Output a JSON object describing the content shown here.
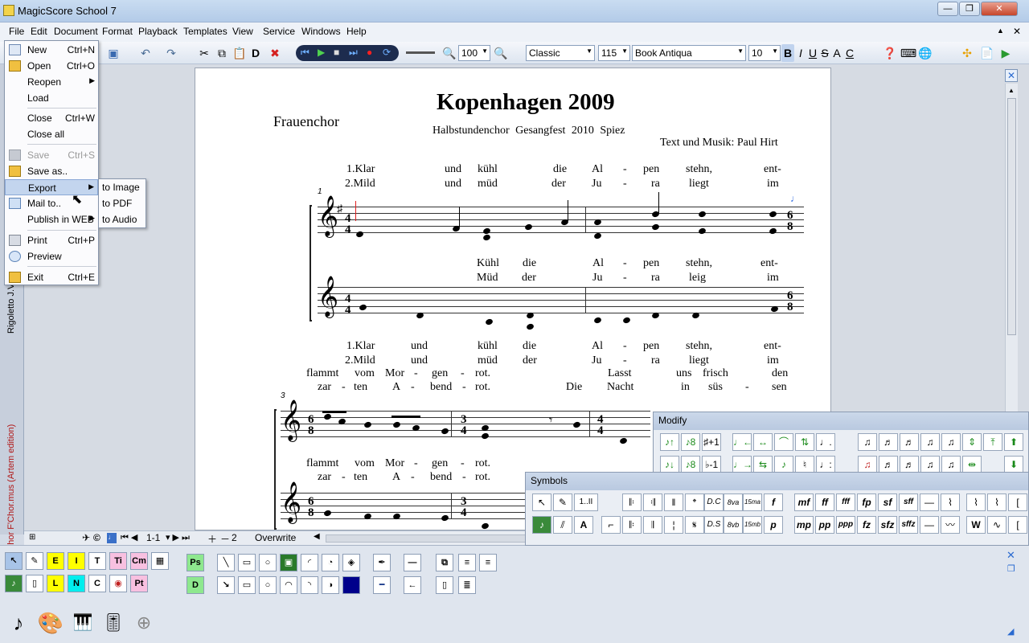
{
  "window": {
    "title": "MagicScore School 7"
  },
  "menubar": {
    "items": [
      "File",
      "Edit",
      "Document",
      "Format",
      "Playback",
      "Templates",
      "View",
      "Service",
      "Windows",
      "Help"
    ]
  },
  "toolbar": {
    "zoom_value": "100",
    "style_combo": "Classic",
    "size_combo": "115",
    "font_combo": "Book Antiqua",
    "fontsize_combo": "10",
    "format_buttons": [
      "B",
      "I",
      "U",
      "S",
      "A",
      "C"
    ],
    "d_button": "D"
  },
  "file_menu": {
    "items": [
      {
        "label": "New",
        "shortcut": "Ctrl+N",
        "icon": "new-document-icon"
      },
      {
        "label": "Open",
        "shortcut": "Ctrl+O",
        "icon": "open-folder-icon"
      },
      {
        "label": "Reopen",
        "shortcut": ""
      },
      {
        "label": "Load",
        "shortcut": ""
      },
      {
        "label": "Close",
        "shortcut": "Ctrl+W"
      },
      {
        "label": "Close all",
        "shortcut": ""
      },
      {
        "label": "Save",
        "shortcut": "Ctrl+S",
        "icon": "save-disk-icon",
        "disabled": true
      },
      {
        "label": "Save as..",
        "shortcut": "",
        "icon": "save-as-icon"
      },
      {
        "label": "Export",
        "shortcut": ""
      },
      {
        "label": "Mail to..",
        "shortcut": "",
        "icon": "mail-icon"
      },
      {
        "label": "Publish in WEB",
        "shortcut": ""
      },
      {
        "label": "Print",
        "shortcut": "Ctrl+P",
        "icon": "printer-icon"
      },
      {
        "label": "Preview",
        "shortcut": "",
        "icon": "preview-icon"
      },
      {
        "label": "Exit",
        "shortcut": "Ctrl+E",
        "icon": "exit-icon"
      }
    ]
  },
  "export_submenu": {
    "items": [
      "to Image",
      "to PDF",
      "to Audio"
    ]
  },
  "score": {
    "title": "Kopenhagen 2009",
    "subtitle": "Halbstundenchor Gesangfest 2010 Spiez",
    "choir": "Frauenchor",
    "composer": "Text und Musik: Paul Hirt",
    "measure_1": "1",
    "measure_3": "3",
    "key_sig": "♯",
    "ts_44": "4",
    "ts_68": "6",
    "ts_68b": "8",
    "ts_34": "3",
    "ts_34b": "4",
    "lyrics": {
      "l1": [
        "1.Klar",
        "und",
        "kühl",
        "die",
        "Al",
        "-",
        "pen",
        "stehn,",
        "ent-"
      ],
      "l2": [
        "2.Mild",
        "und",
        "müd",
        "der",
        "Ju",
        "-",
        "ra",
        "liegt",
        "im"
      ],
      "l3": [
        "Kühl",
        "die",
        "Al",
        "-",
        "pen",
        "stehn,",
        "ent-"
      ],
      "l4": [
        "Müd",
        "der",
        "Ju",
        "-",
        "ra",
        "leig",
        "im"
      ],
      "l5": [
        "1.Klar",
        "und",
        "kühl",
        "die",
        "Al",
        "-",
        "pen",
        "stehn,",
        "ent-"
      ],
      "l6": [
        "2.Mild",
        "und",
        "müd",
        "der",
        "Ju",
        "-",
        "ra",
        "liegt",
        "im"
      ],
      "l7": [
        "flammt",
        "vom",
        "Mor",
        "-",
        "gen",
        "-",
        "rot.",
        "Lasst",
        "uns",
        "frisch",
        "den"
      ],
      "l8": [
        "zar",
        "-",
        "ten",
        "A",
        "-",
        "bend",
        "-",
        "rot.",
        "Die",
        "Nacht",
        "in",
        "süs",
        "-",
        "sen"
      ],
      "l9": [
        "flammt",
        "vom",
        "Mor",
        "-",
        "gen",
        "-",
        "rot."
      ],
      "l10": [
        "zar",
        "-",
        "ten",
        "A",
        "-",
        "bend",
        "-",
        "rot."
      ]
    }
  },
  "left_tabs": {
    "tab1": "Rigoletto J.V...",
    "tab2": "Halbstundenchor F'Chor.mus (Artem edition)"
  },
  "statusbar": {
    "pages": "1-1",
    "count": "2",
    "mode": "Overwrite"
  },
  "modify_panel": {
    "title": "Modify"
  },
  "symbols_panel": {
    "title": "Symbols",
    "row1": [
      "D.C",
      "8va",
      "15ma",
      "f",
      "mf",
      "ff",
      "fff",
      "fp",
      "sf",
      "sff"
    ],
    "row2": [
      "D.S",
      "8vb",
      "15mb",
      "p",
      "mp",
      "pp",
      "ppp",
      "fz",
      "sfz",
      "sffz"
    ]
  },
  "bottom_panel": {
    "buttons": [
      "E",
      "I",
      "T",
      "Ti",
      "Cm",
      "L",
      "N",
      "C",
      "Pt",
      "Ps",
      "D"
    ]
  }
}
